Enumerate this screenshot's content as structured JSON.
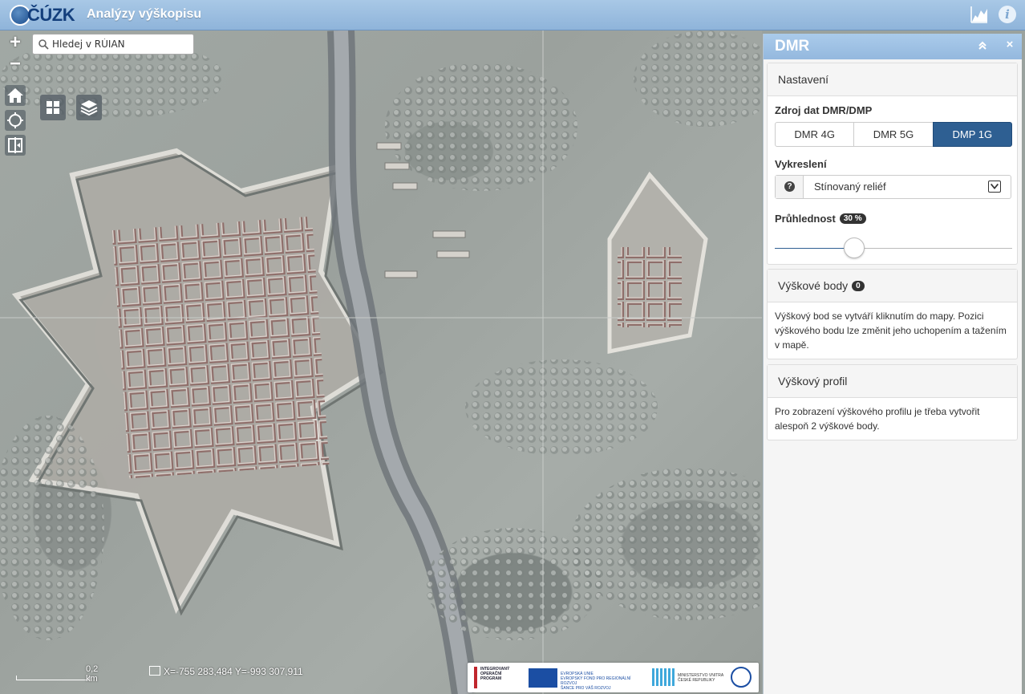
{
  "header": {
    "logo_text": "ČÚZK",
    "title": "Analýzy výškopisu"
  },
  "map": {
    "zoom_in": "+",
    "zoom_out": "−",
    "search": {
      "placeholder": "Hledej v RÚIAN"
    },
    "scale_label": "0,2 km",
    "coordinates": "X=-755 283,484  Y=-993 307,911"
  },
  "panel": {
    "title": "DMR",
    "collapse": "«",
    "close": "×",
    "settings": {
      "title": "Nastavení",
      "source_label": "Zdroj dat DMR/DMP",
      "sources": [
        "DMR 4G",
        "DMR 5G",
        "DMP 1G"
      ],
      "active_source": "DMP 1G",
      "render_label": "Vykreslení",
      "help": "?",
      "render_value": "Stínovaný reliéf",
      "opacity_label": "Průhlednost",
      "opacity_value": "30 %",
      "opacity_fraction": 0.32
    },
    "points": {
      "title": "Výškové body",
      "count": "0",
      "text": "Výškový bod se vytváří kliknutím do mapy. Pozici výškového bodu lze změnit jeho uchopením a tažením v mapě."
    },
    "profile": {
      "title": "Výškový profil",
      "text": "Pro zobrazení výškového profilu je třeba vytvořit alespoň 2 výškové body."
    }
  },
  "colors": {
    "header": "#94b8de",
    "active_button": "#2e5f92"
  }
}
